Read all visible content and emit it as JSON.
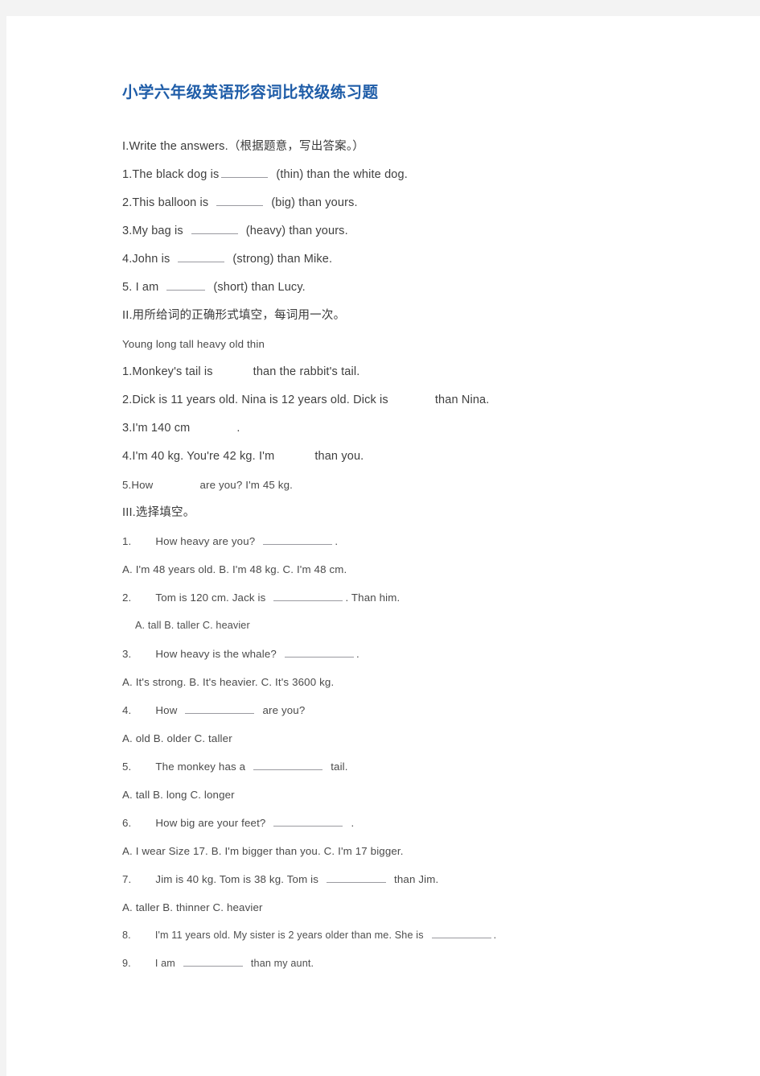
{
  "document": {
    "title": "小学六年级英语形容词比较级练习题",
    "title_color": "#1f5da8",
    "body_color": "#3f3f3f",
    "page_background": "#ffffff",
    "canvas_background": "#f3f3f3"
  },
  "section1": {
    "heading": "I.Write  the  answers.（根据题意，写出答案。）",
    "items": [
      {
        "pre": "1.The  black  dog  is",
        "post": "(thin)  than  the  white  dog."
      },
      {
        "pre": "2.This  balloon  is",
        "post": "(big)  than  yours."
      },
      {
        "pre": "3.My  bag  is",
        "post": "(heavy)  than  yours."
      },
      {
        "pre": "4.John  is",
        "post": "(strong)  than  Mike."
      },
      {
        "pre": "5.  I  am",
        "post": "(short)  than  Lucy."
      }
    ]
  },
  "section2": {
    "heading": "II.用所给词的正确形式填空，每词用一次。",
    "word_bank": "Young    long    tall    heavy    old    thin",
    "items": [
      {
        "pre": "1.Monkey's  tail  is",
        "post": "than  the  rabbit's  tail."
      },
      {
        "pre": "2.Dick  is  11  years  old.  Nina  is  12  years  old.  Dick  is",
        "post": "than  Nina."
      },
      {
        "pre": "3.I'm  140  cm",
        "post": "."
      },
      {
        "pre": "4.I'm  40  kg.  You're  42  kg.  I'm",
        "post": "than  you."
      },
      {
        "pre": "5.How",
        "post": "are  you?  I'm  45  kg."
      }
    ]
  },
  "section3": {
    "heading": "III.选择填空。",
    "questions": [
      {
        "number": "1.",
        "pre": "How  heavy  are  you?",
        "post": ".",
        "choices": "A.  I'm  48  years  old.  B.  I'm  48  kg.    C.  I'm  48  cm."
      },
      {
        "number": "2.",
        "pre": "Tom  is  120  cm.  Jack  is",
        "post": ".  Than  him.",
        "choices": "A.  tall    B.  taller    C.  heavier"
      },
      {
        "number": "3.",
        "pre": "How  heavy  is  the  whale?",
        "post": ".",
        "choices": "A.      It's  strong.  B.  It's  heavier.  C.  It's  3600  kg."
      },
      {
        "number": "4.",
        "pre": "How",
        "post": "are  you?",
        "choices": "A.  old    B.  older  C.  taller"
      },
      {
        "number": "5.",
        "pre": "The  monkey  has  a",
        "post": "tail.",
        "choices": "A.  tall    B.  long  C.  longer"
      },
      {
        "number": "6.",
        "pre": "How  big  are  your  feet?",
        "post": ".",
        "choices": "A.  I  wear  Size  17.  B.  I'm  bigger  than  you.  C.  I'm  17  bigger."
      },
      {
        "number": "7.",
        "pre": "Jim  is  40  kg.  Tom  is  38  kg.  Tom  is",
        "post": "than  Jim.",
        "choices": "A.  taller    B.  thinner  C.  heavier"
      },
      {
        "number": "8.",
        "pre": "I'm  11  years  old.  My  sister  is  2  years  older  than  me.  She  is",
        "post": ".",
        "choices": ""
      },
      {
        "number": "9.",
        "pre": "I  am",
        "post": "than  my  aunt.",
        "choices": ""
      }
    ]
  }
}
